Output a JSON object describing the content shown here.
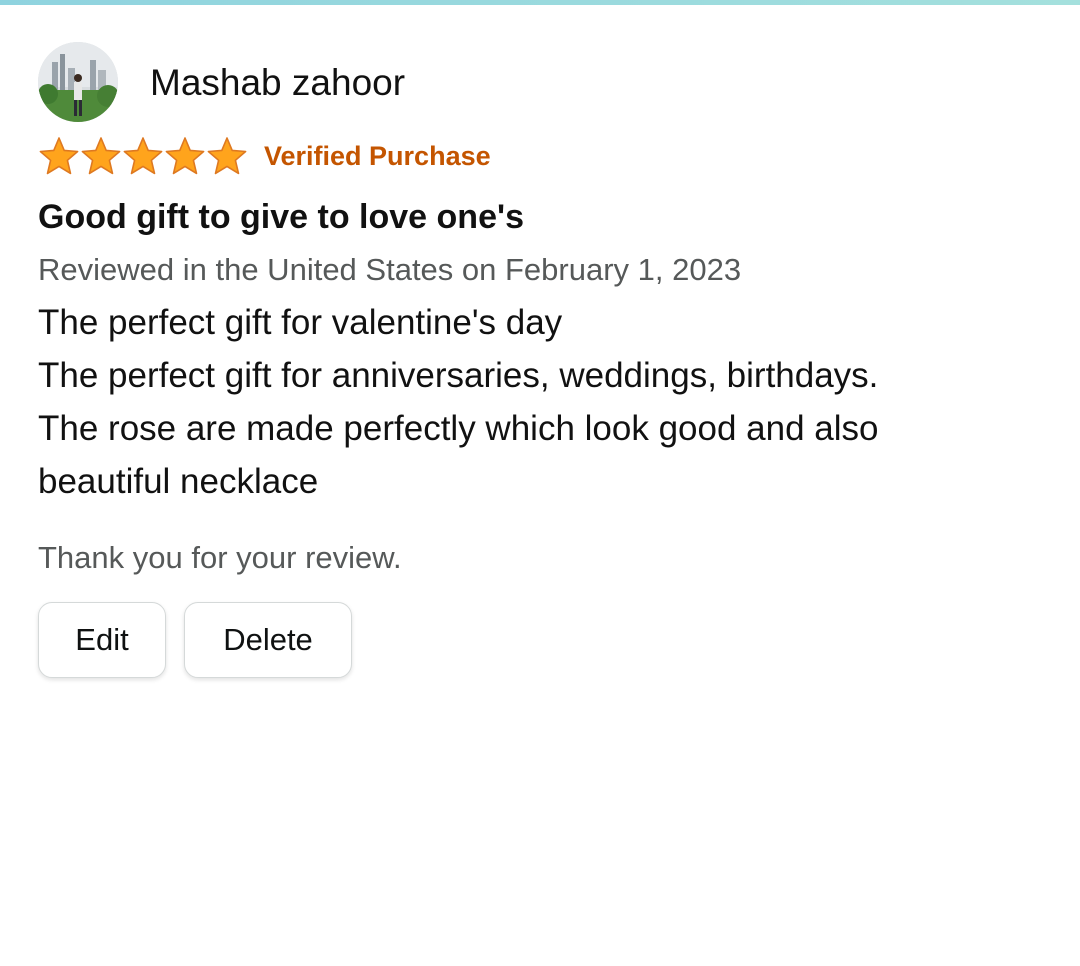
{
  "review": {
    "profile_name": "Mashab zahoor",
    "rating": 5,
    "rating_max": 5,
    "verified_label": "Verified Purchase",
    "title": "Good gift to give to love one's",
    "date_line": "Reviewed in the United States on February 1, 2023",
    "body_lines": [
      "The perfect gift for valentine's day",
      "The perfect gift for anniversaries, weddings, birthdays.",
      "The rose are made perfectly which look good and also",
      "beautiful necklace"
    ],
    "thanks_text": "Thank you for your review."
  },
  "actions": {
    "edit_label": "Edit",
    "delete_label": "Delete"
  },
  "colors": {
    "star_fill": "#ffa41c",
    "star_stroke": "#de7921",
    "verified": "#c45500",
    "muted_text": "#565959",
    "accent_bar": "#8fd3df"
  },
  "icons": {
    "avatar": "profile-photo",
    "star": "star-icon"
  }
}
